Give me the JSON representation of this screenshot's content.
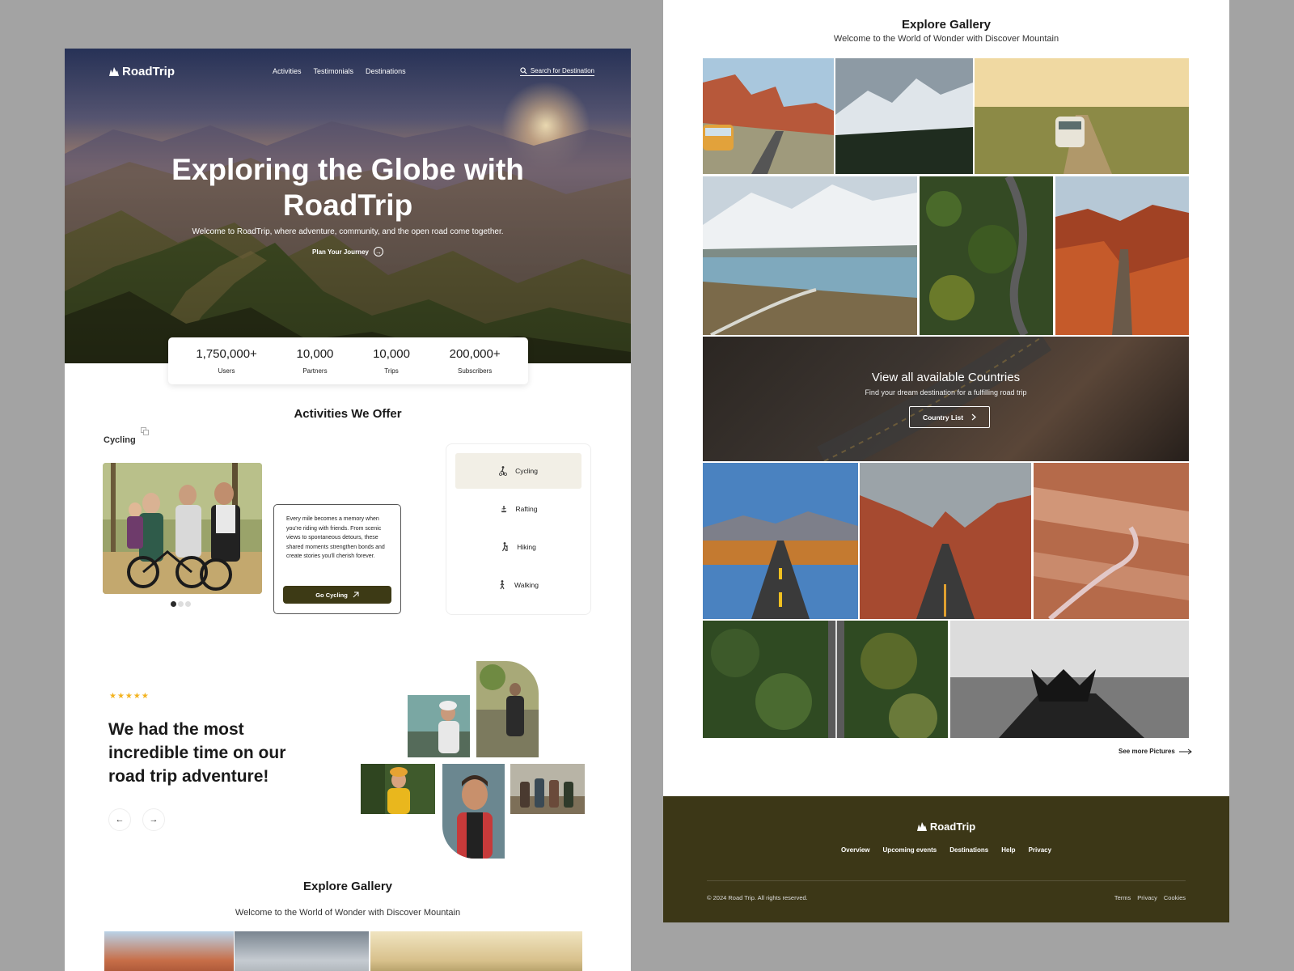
{
  "brand": {
    "name": "RoadTrip"
  },
  "nav": {
    "links": [
      "Activities",
      "Testimonials",
      "Destinations"
    ],
    "search_label": "Search for Destination"
  },
  "hero": {
    "title_line1": "Exploring the Globe with",
    "title_line2": "RoadTrip",
    "subtitle": "Welcome to RoadTrip, where adventure, community, and the open road come together.",
    "cta": "Plan Your Journey"
  },
  "stats": [
    {
      "value": "1,750,000+",
      "label": "Users"
    },
    {
      "value": "10,000",
      "label": "Partners"
    },
    {
      "value": "10,000",
      "label": "Trips"
    },
    {
      "value": "200,000+",
      "label": "Subscribers"
    }
  ],
  "activities": {
    "title": "Activities We Offer",
    "current_label": "Cycling",
    "description": "Every mile becomes a memory when you're riding with friends. From scenic views to spontaneous detours, these shared moments strengthen bonds and create stories you'll cherish forever.",
    "button": "Go Cycling",
    "items": [
      "Cycling",
      "Rafting",
      "Hiking",
      "Walking"
    ],
    "selected_index": 0,
    "carousel_dots": 3,
    "carousel_active": 0
  },
  "testimonial": {
    "stars": "★★★★★",
    "rating": 5,
    "quote": "We had the most incredible time on our road trip adventure!"
  },
  "gallery": {
    "title": "Explore Gallery",
    "subtitle": "Welcome to the World of Wonder with Discover Mountain",
    "see_more": "See more Pictures"
  },
  "countries": {
    "title": "View all available Countries",
    "subtitle": "Find your dream destination for a fulfilling road trip",
    "button": "Country List"
  },
  "footer": {
    "links": [
      "Overview",
      "Upcoming events",
      "Destinations",
      "Help",
      "Privacy"
    ],
    "copyright": "© 2024 Road Trip. All rights reserved.",
    "legal": [
      "Terms",
      "Privacy",
      "Cookies"
    ]
  },
  "colors": {
    "footer_bg": "#3c3717",
    "button_dark": "#3d3a15",
    "star": "#f3b31f",
    "selected_item_bg": "#f2efe6",
    "canvas_bg": "#a3a3a3"
  }
}
